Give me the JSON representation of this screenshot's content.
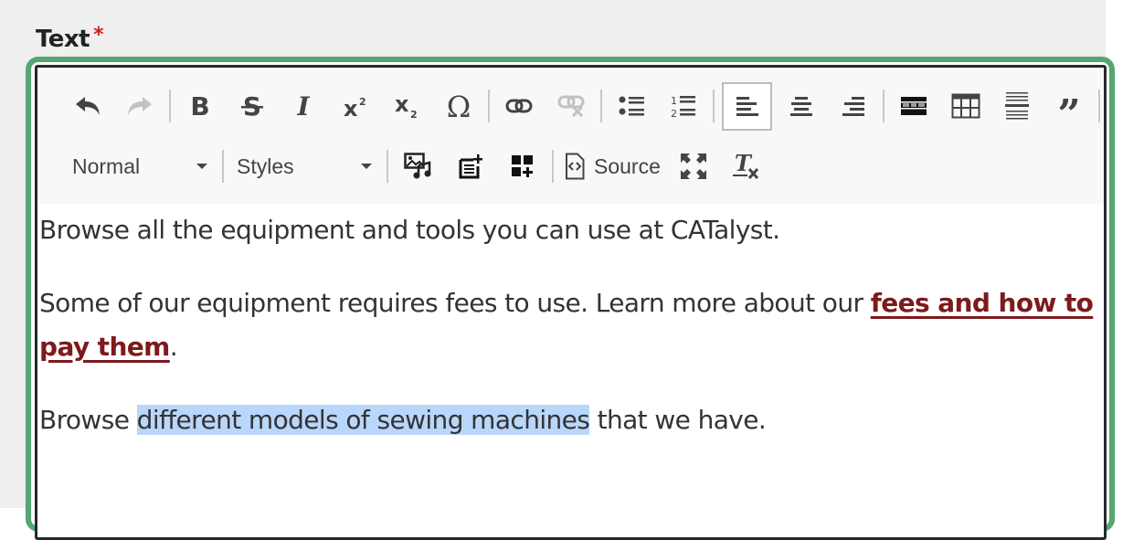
{
  "field": {
    "label": "Text",
    "required_marker": "*"
  },
  "colors": {
    "focus_ring": "#55a672",
    "link": "#7d1a1d",
    "selection": "#b9d6fb",
    "required": "#cc2222"
  },
  "toolbar": {
    "row1": [
      {
        "name": "undo",
        "icon": "undo-icon",
        "state": "enabled"
      },
      {
        "name": "redo",
        "icon": "redo-icon",
        "state": "disabled"
      },
      {
        "name": "bold",
        "icon": "bold-icon"
      },
      {
        "name": "strikethrough",
        "icon": "strikethrough-icon"
      },
      {
        "name": "italic",
        "icon": "italic-icon"
      },
      {
        "name": "superscript",
        "icon": "superscript-icon"
      },
      {
        "name": "subscript",
        "icon": "subscript-icon"
      },
      {
        "name": "special-character",
        "icon": "omega-icon"
      },
      {
        "name": "link",
        "icon": "link-icon"
      },
      {
        "name": "unlink",
        "icon": "unlink-icon",
        "state": "disabled"
      },
      {
        "name": "bulleted-list",
        "icon": "bulleted-list-icon"
      },
      {
        "name": "numbered-list",
        "icon": "numbered-list-icon"
      },
      {
        "name": "align-left",
        "icon": "align-left-icon",
        "state": "active"
      },
      {
        "name": "align-center",
        "icon": "align-center-icon"
      },
      {
        "name": "align-right",
        "icon": "align-right-icon"
      },
      {
        "name": "template",
        "icon": "template-icon"
      },
      {
        "name": "table",
        "icon": "table-icon"
      },
      {
        "name": "horizontal-rule",
        "icon": "horizontal-rule-icon"
      },
      {
        "name": "blockquote",
        "icon": "blockquote-icon"
      }
    ],
    "row2": {
      "format_select": "Normal",
      "styles_select": "Styles",
      "source_label": "Source"
    }
  },
  "content": {
    "paragraph1": "Browse all the equipment and tools you can use at CATalyst.",
    "paragraph2_before": "Some of our equipment requires fees to use. Learn more about our ",
    "paragraph2_link": "fees and how to pay them",
    "paragraph2_after": ".",
    "paragraph3_before": "Browse ",
    "paragraph3_selected": "different models of sewing machines",
    "paragraph3_after": " that we have."
  }
}
